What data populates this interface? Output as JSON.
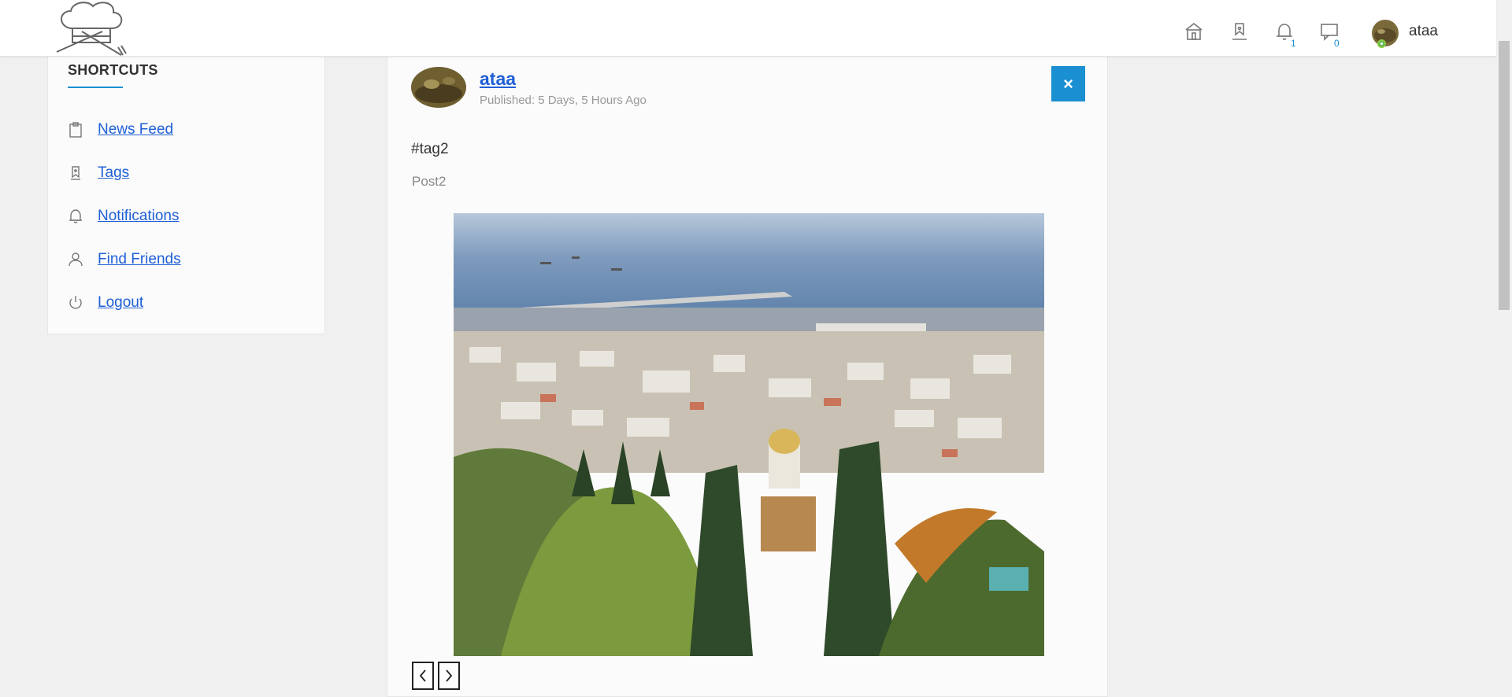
{
  "header": {
    "home_icon": "home-icon",
    "tags_icon": "tag-icon",
    "notifications_icon": "bell-icon",
    "notifications_count": "1",
    "messages_icon": "message-icon",
    "messages_count": "0",
    "username": "ataa",
    "accent": "#1a8fd1"
  },
  "sidebar": {
    "title": "SHORTCUTS",
    "items": [
      {
        "label": "News Feed",
        "icon": "clipboard-icon"
      },
      {
        "label": "Tags",
        "icon": "tag-icon"
      },
      {
        "label": "Notifications",
        "icon": "bell-icon"
      },
      {
        "label": "Find Friends",
        "icon": "user-icon"
      },
      {
        "label": "Logout",
        "icon": "power-icon"
      }
    ]
  },
  "post": {
    "author": "ataa",
    "published": "Published: 5 Days, 5 Hours Ago",
    "close_label": "×",
    "tag": "#tag2",
    "body": "Post2",
    "prev_icon": "chevron-left-icon",
    "next_icon": "chevron-right-icon"
  }
}
